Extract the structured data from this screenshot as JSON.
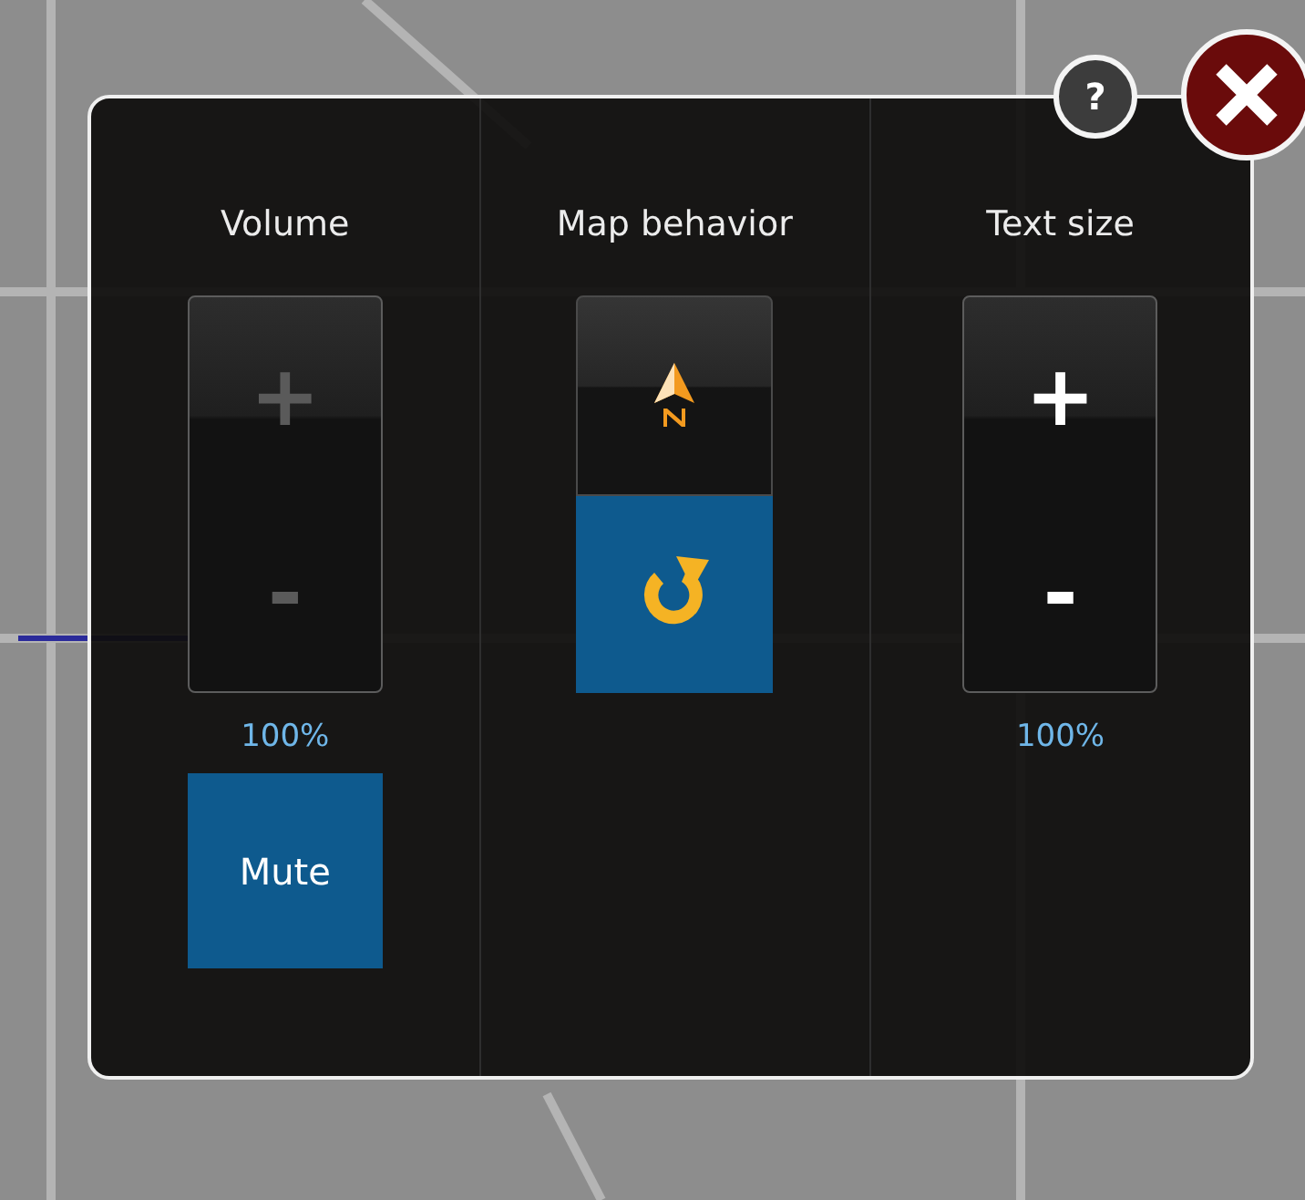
{
  "help_button": {
    "label": "?"
  },
  "columns": [
    {
      "kind": "stepper",
      "title": "Volume",
      "plus": {
        "label": "+",
        "disabled": true
      },
      "minus": {
        "label": "-",
        "disabled": true
      },
      "reading": "100%",
      "button": {
        "label": "Mute"
      }
    },
    {
      "kind": "toggle",
      "title": "Map behavior",
      "options": [
        {
          "kind": "north",
          "selected": false
        },
        {
          "kind": "rotate",
          "selected": true
        }
      ]
    },
    {
      "kind": "stepper",
      "title": "Text size",
      "plus": {
        "label": "+",
        "disabled": false
      },
      "minus": {
        "label": "-",
        "disabled": false
      },
      "reading": "100%"
    }
  ]
}
